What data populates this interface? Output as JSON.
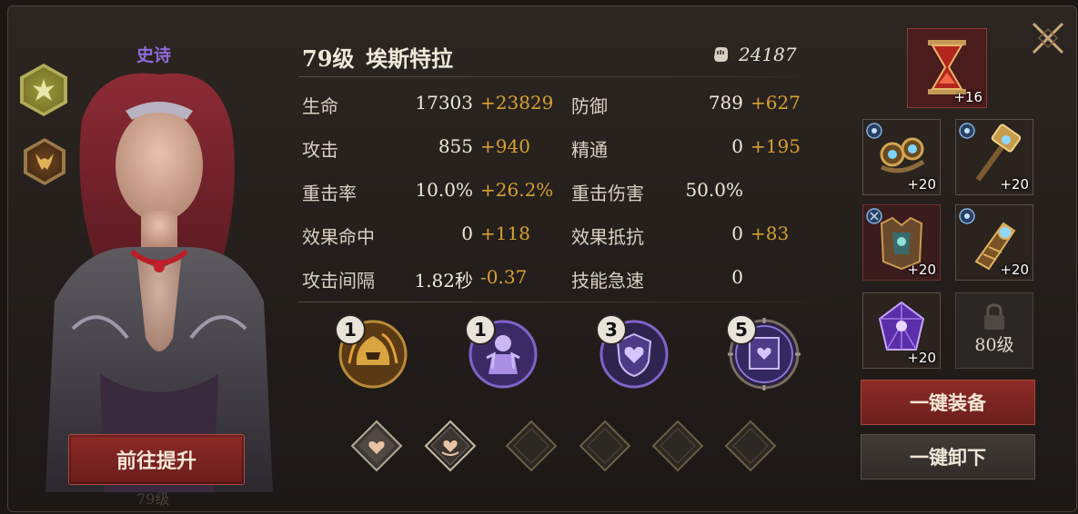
{
  "hero": {
    "rarity": "史诗",
    "level": "79级",
    "name": "埃斯特拉",
    "power": "24187",
    "faction_icon": "faction-crest-icon",
    "class_icon": "horned-demon-icon"
  },
  "stats": [
    {
      "label": "生命",
      "base": "17303",
      "bonus": "+23829"
    },
    {
      "label": "防御",
      "base": "789",
      "bonus": "+627"
    },
    {
      "label": "攻击",
      "base": "855",
      "bonus": "+940"
    },
    {
      "label": "精通",
      "base": "0",
      "bonus": "+195"
    },
    {
      "label": "重击率",
      "base": "10.0%",
      "bonus": "+26.2%"
    },
    {
      "label": "重击伤害",
      "base": "50.0%",
      "bonus": ""
    },
    {
      "label": "效果命中",
      "base": "0",
      "bonus": "+118"
    },
    {
      "label": "效果抵抗",
      "base": "0",
      "bonus": "+83"
    },
    {
      "label": "攻击间隔",
      "base": "1.82秒",
      "bonus": "-0.37"
    },
    {
      "label": "技能急速",
      "base": "0",
      "bonus": ""
    }
  ],
  "skills": [
    {
      "level": "1",
      "icon": "flame-helmet-icon"
    },
    {
      "level": "1",
      "icon": "armored-knight-icon"
    },
    {
      "level": "3",
      "icon": "heart-shield-icon"
    },
    {
      "level": "5",
      "icon": "heart-banner-icon"
    }
  ],
  "gems": [
    {
      "icon": "heart-gem-icon",
      "state": "filled"
    },
    {
      "icon": "heart-rune-gem-icon",
      "state": "filled"
    },
    {
      "icon": "empty-gem-slot-icon",
      "state": "empty"
    },
    {
      "icon": "empty-gem-slot-icon",
      "state": "empty"
    },
    {
      "icon": "empty-gem-slot-icon",
      "state": "empty"
    },
    {
      "icon": "empty-gem-slot-icon",
      "state": "empty"
    }
  ],
  "equipment": {
    "relic": {
      "icon": "hourglass-relic-icon",
      "count": "+16"
    },
    "items": [
      {
        "icon": "goggles-icon",
        "count": "+20"
      },
      {
        "icon": "hammer-icon",
        "count": "+20"
      },
      {
        "icon": "armor-icon",
        "count": "+20"
      },
      {
        "icon": "gauntlet-icon",
        "count": "+20"
      },
      {
        "icon": "purple-crystal-icon",
        "count": "+20"
      }
    ],
    "locked_label": "80级"
  },
  "buttons": {
    "promote": "前往提升",
    "equip_all": "一键装备",
    "unequip_all": "一键卸下"
  },
  "colors": {
    "bonus": "#d6a033",
    "rarity_epic": "#8f6bd8",
    "primary_button": "#8c2a26"
  }
}
